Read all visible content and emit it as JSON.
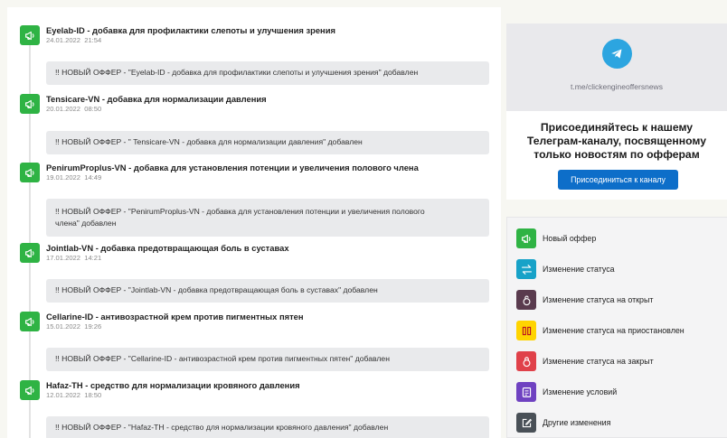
{
  "colors": {
    "new_offer": "#2fb344",
    "status_change": "#17a2c8",
    "status_open": "#5a3b4e",
    "status_paused": "#ffd400",
    "status_closed": "#e0414a",
    "terms_change": "#6f42c1",
    "other_change": "#495057",
    "telegram": "#2ca5e0",
    "button": "#0d6ec9"
  },
  "feed": {
    "items": [
      {
        "icon": "megaphone-icon",
        "title": "Eyelab-ID - добавка для профилактики слепоты и улучшения зрения",
        "date": "24.01.2022  21:54",
        "message": "!! НОВЫЙ ОФФЕР - \"Eyelab-ID - добавка для профилактики слепоты и улучшения зрения\" добавлен"
      },
      {
        "icon": "megaphone-icon",
        "title": "Tensicare-VN - добавка для нормализации давления",
        "date": "20.01.2022  08:50",
        "message": "!! НОВЫЙ ОФФЕР - \" Tensicare-VN - добавка для нормализации давления\" добавлен"
      },
      {
        "icon": "megaphone-icon",
        "title": "PenirumProplus-VN - добавка для установления потенции и увеличения полового члена",
        "date": "19.01.2022  14:49",
        "message_line1": "!! НОВЫЙ ОФФЕР - \"PenirumProplus-VN - добавка для установления потенции и увеличения полового",
        "message_line2": "члена\" добавлен"
      },
      {
        "icon": "megaphone-icon",
        "title": "Jointlab-VN - добавка предотвращающая боль в суставах",
        "date": "17.01.2022  14:21",
        "message": "!! НОВЫЙ ОФФЕР - \"Jointlab-VN - добавка предотвращающая боль в суставах\" добавлен"
      },
      {
        "icon": "megaphone-icon",
        "title": "Cellarine-ID - антивозрастной крем против пигментных пятен",
        "date": "15.01.2022  19:26",
        "message": "!! НОВЫЙ ОФФЕР - \"Cellarine-ID - антивозрастной крем против пигментных пятен\" добавлен"
      },
      {
        "icon": "megaphone-icon",
        "title": "Hafaz-TH - средство для нормализации кровяного давления",
        "date": "12.01.2022  18:50",
        "message": "!! НОВЫЙ ОФФЕР - \"Hafaz-TH - средство для нормализации кровяного давления\" добавлен"
      }
    ]
  },
  "telegram": {
    "icon": "telegram-icon",
    "link": "t.me/clickengineoffersnews",
    "heading": "Присоединяйтесь к нашему Телеграм-каналу, посвященному только новостям по офферам",
    "button": "Присоединиться к каналу"
  },
  "legend": {
    "items": [
      {
        "icon": "megaphone-icon",
        "label": "Новый оффер"
      },
      {
        "icon": "swap-arrows-icon",
        "label": "Изменение статуса"
      },
      {
        "icon": "open-lock-icon",
        "label": "Изменение статуса на открыт"
      },
      {
        "icon": "pause-icon",
        "label": "Изменение статуса на приостановлен"
      },
      {
        "icon": "closed-lock-icon",
        "label": "Изменение статуса на закрыт"
      },
      {
        "icon": "document-icon",
        "label": "Изменение условий"
      },
      {
        "icon": "edit-icon",
        "label": "Другие изменения"
      }
    ]
  }
}
